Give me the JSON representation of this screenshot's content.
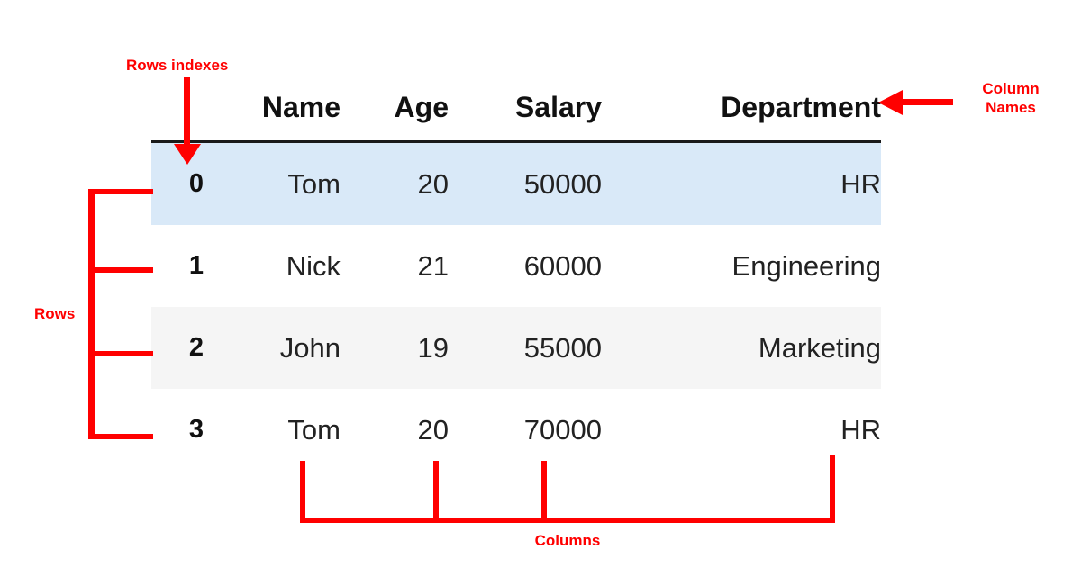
{
  "table": {
    "index_header": "",
    "columns": [
      "Name",
      "Age",
      "Salary",
      "Department"
    ],
    "rows": [
      {
        "index": "0",
        "name": "Tom",
        "age": "20",
        "salary": "50000",
        "department": "HR"
      },
      {
        "index": "1",
        "name": "Nick",
        "age": "21",
        "salary": "60000",
        "department": "Engineering"
      },
      {
        "index": "2",
        "name": "John",
        "age": "19",
        "salary": "55000",
        "department": "Marketing"
      },
      {
        "index": "3",
        "name": "Tom",
        "age": "20",
        "salary": "70000",
        "department": "HR"
      }
    ],
    "row_styles": [
      "highlight",
      "plain",
      "alternate",
      "plain"
    ],
    "highlight_color": "#d9e9f8",
    "alternate_color": "#f5f5f5",
    "header_rule_color": "#1a1a1a"
  },
  "annotations": {
    "accent_color": "#ff0000",
    "rows_indexes_label": "Rows indexes",
    "column_names_label": "Column\nNames",
    "rows_label": "Rows",
    "columns_label": "Columns"
  }
}
